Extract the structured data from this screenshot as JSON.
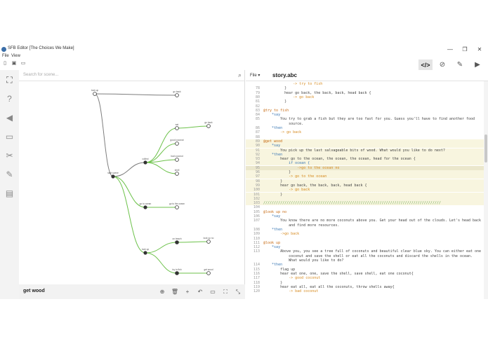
{
  "window": {
    "title": "SFB Editor [The Choices We Make]",
    "minimize": "—",
    "restore": "❐",
    "close": "✕"
  },
  "menu": {
    "file": "File",
    "view": "View"
  },
  "toolbar": {
    "new_icon": "▯",
    "save_icon": "▣",
    "open_icon": "▭"
  },
  "modes": {
    "code": "</>",
    "explore": "⊘",
    "edit": "✎",
    "play": "▶"
  },
  "sidebar": {
    "items": [
      {
        "name": "graph",
        "glyph": "⛶"
      },
      {
        "name": "help",
        "glyph": "?"
      },
      {
        "name": "audio",
        "glyph": "◀"
      },
      {
        "name": "images",
        "glyph": "▭"
      },
      {
        "name": "tools",
        "glyph": "✂"
      },
      {
        "name": "pen",
        "glyph": "✎"
      },
      {
        "name": "id",
        "glyph": "▤"
      }
    ]
  },
  "search": {
    "placeholder": "Search for scene...",
    "icon": "⌕"
  },
  "graph": {
    "selected_scene": "get wood",
    "tools": {
      "target": "⊕",
      "delete": "🗑",
      "add": "+",
      "undo": "↶",
      "folder": "▭",
      "expand": "⛶",
      "collapse": "⤡"
    },
    "labels": {
      "root": "start scene",
      "collect": "collect",
      "lookup": "look up",
      "ocean": "go to ocean",
      "fish": "try to fish",
      "wood": "get wood",
      "lookup_no": "look up no",
      "tree": "look up",
      "eat": "eat",
      "back": "go back",
      "good": "good coconut",
      "bad": "bad coconut",
      "shell": "shell",
      "gocean": "go to the ocean",
      "again": "go back",
      "beach": "on beach"
    }
  },
  "colors": {
    "edge_green": "#6dc24b",
    "edge_gray": "#7d7d7d",
    "node": "#333333"
  },
  "editor": {
    "file_menu": "File",
    "file_name": "story.abc",
    "lines": [
      {
        "n": "",
        "t": "              -> try to fish",
        "c": "link"
      },
      {
        "n": "78",
        "t": "          }",
        "c": "punct"
      },
      {
        "n": "79",
        "t": "          hear go back, the back, back, head back {",
        "c": "plain"
      },
      {
        "n": "80",
        "t": "              -> go back",
        "c": "link"
      },
      {
        "n": "81",
        "t": "          }",
        "c": "punct"
      },
      {
        "n": "82",
        "t": "",
        "c": "plain"
      },
      {
        "n": "83",
        "t": "@try to fish",
        "c": "section"
      },
      {
        "n": "84",
        "t": "    *say",
        "c": "kw"
      },
      {
        "n": "85",
        "t": "        You try to grab a fish but they are too fast for you. Guess you'll have to find another food",
        "c": "plain"
      },
      {
        "n": "",
        "t": "            source.",
        "c": "plain"
      },
      {
        "n": "86",
        "t": "    *then",
        "c": "kw"
      },
      {
        "n": "87",
        "t": "        -> go back",
        "c": "link"
      },
      {
        "n": "88",
        "t": "",
        "c": "plain"
      },
      {
        "n": "89",
        "t": "@get wood",
        "c": "section",
        "hl": true
      },
      {
        "n": "90",
        "t": "    *say",
        "c": "kw",
        "hl": true
      },
      {
        "n": "91",
        "t": "        You pick up the last salvageable bits of wood. What would you like to do next?",
        "c": "plain",
        "hl": true
      },
      {
        "n": "92",
        "t": "    *then",
        "c": "kw",
        "hl": true
      },
      {
        "n": "93",
        "t": "        hear go to the ocean, the ocean, the ocean, head for the ocean {",
        "c": "plain",
        "hl": true
      },
      {
        "n": "94",
        "t": "            if ocean {",
        "c": "kw",
        "hl": true
      },
      {
        "n": "95",
        "t": "                ->go to the ocean no",
        "c": "link",
        "cur": true
      },
      {
        "n": "96",
        "t": "            }",
        "c": "punct",
        "hl": true
      },
      {
        "n": "97",
        "t": "            -> go to the ocean",
        "c": "link",
        "hl": true
      },
      {
        "n": "98",
        "t": "        }",
        "c": "punct",
        "hl": true
      },
      {
        "n": "99",
        "t": "        hear go back, the back, back, head back {",
        "c": "plain",
        "hl": true
      },
      {
        "n": "100",
        "t": "            -> go back",
        "c": "link",
        "hl": true
      },
      {
        "n": "101",
        "t": "        }",
        "c": "punct",
        "hl": true
      },
      {
        "n": "102",
        "t": "",
        "c": "plain",
        "hl": true
      },
      {
        "n": "103",
        "t": "////////////////////////////////////////////////////////////////////////////////////",
        "c": "comment",
        "hl": true
      },
      {
        "n": "104",
        "t": "",
        "c": "plain"
      },
      {
        "n": "105",
        "t": "@look up no",
        "c": "section"
      },
      {
        "n": "106",
        "t": "    *say",
        "c": "kw"
      },
      {
        "n": "107",
        "t": "        You know there are no more coconuts above you. Get your head out of the clouds. Let's head back",
        "c": "plain"
      },
      {
        "n": "",
        "t": "            and find more resources.",
        "c": "plain"
      },
      {
        "n": "108",
        "t": "    *then",
        "c": "kw"
      },
      {
        "n": "109",
        "t": "        ->go back",
        "c": "link"
      },
      {
        "n": "110",
        "t": "",
        "c": "plain"
      },
      {
        "n": "111",
        "t": "@look up",
        "c": "section"
      },
      {
        "n": "112",
        "t": "    *say",
        "c": "kw"
      },
      {
        "n": "113",
        "t": "        Above you, you see a tree full of coconuts and beautiful clear blue sky. You can either eat one",
        "c": "plain"
      },
      {
        "n": "",
        "t": "            coconut and save the shell or eat all the coconuts and discard the shells in the ocean.",
        "c": "plain"
      },
      {
        "n": "",
        "t": "            What would you like to do?",
        "c": "plain"
      },
      {
        "n": "114",
        "t": "    *then",
        "c": "kw"
      },
      {
        "n": "115",
        "t": "        flag up",
        "c": "plain"
      },
      {
        "n": "116",
        "t": "        hear eat one, one, save the shell, save shell, eat one coconut{",
        "c": "plain"
      },
      {
        "n": "117",
        "t": "            -> good coconut",
        "c": "link"
      },
      {
        "n": "118",
        "t": "        }",
        "c": "punct"
      },
      {
        "n": "119",
        "t": "        hear eat all, eat all the coconuts, throw shells away{",
        "c": "plain"
      },
      {
        "n": "120",
        "t": "            -> bad coconut",
        "c": "link"
      }
    ],
    "scroll_fraction": 0.28
  }
}
